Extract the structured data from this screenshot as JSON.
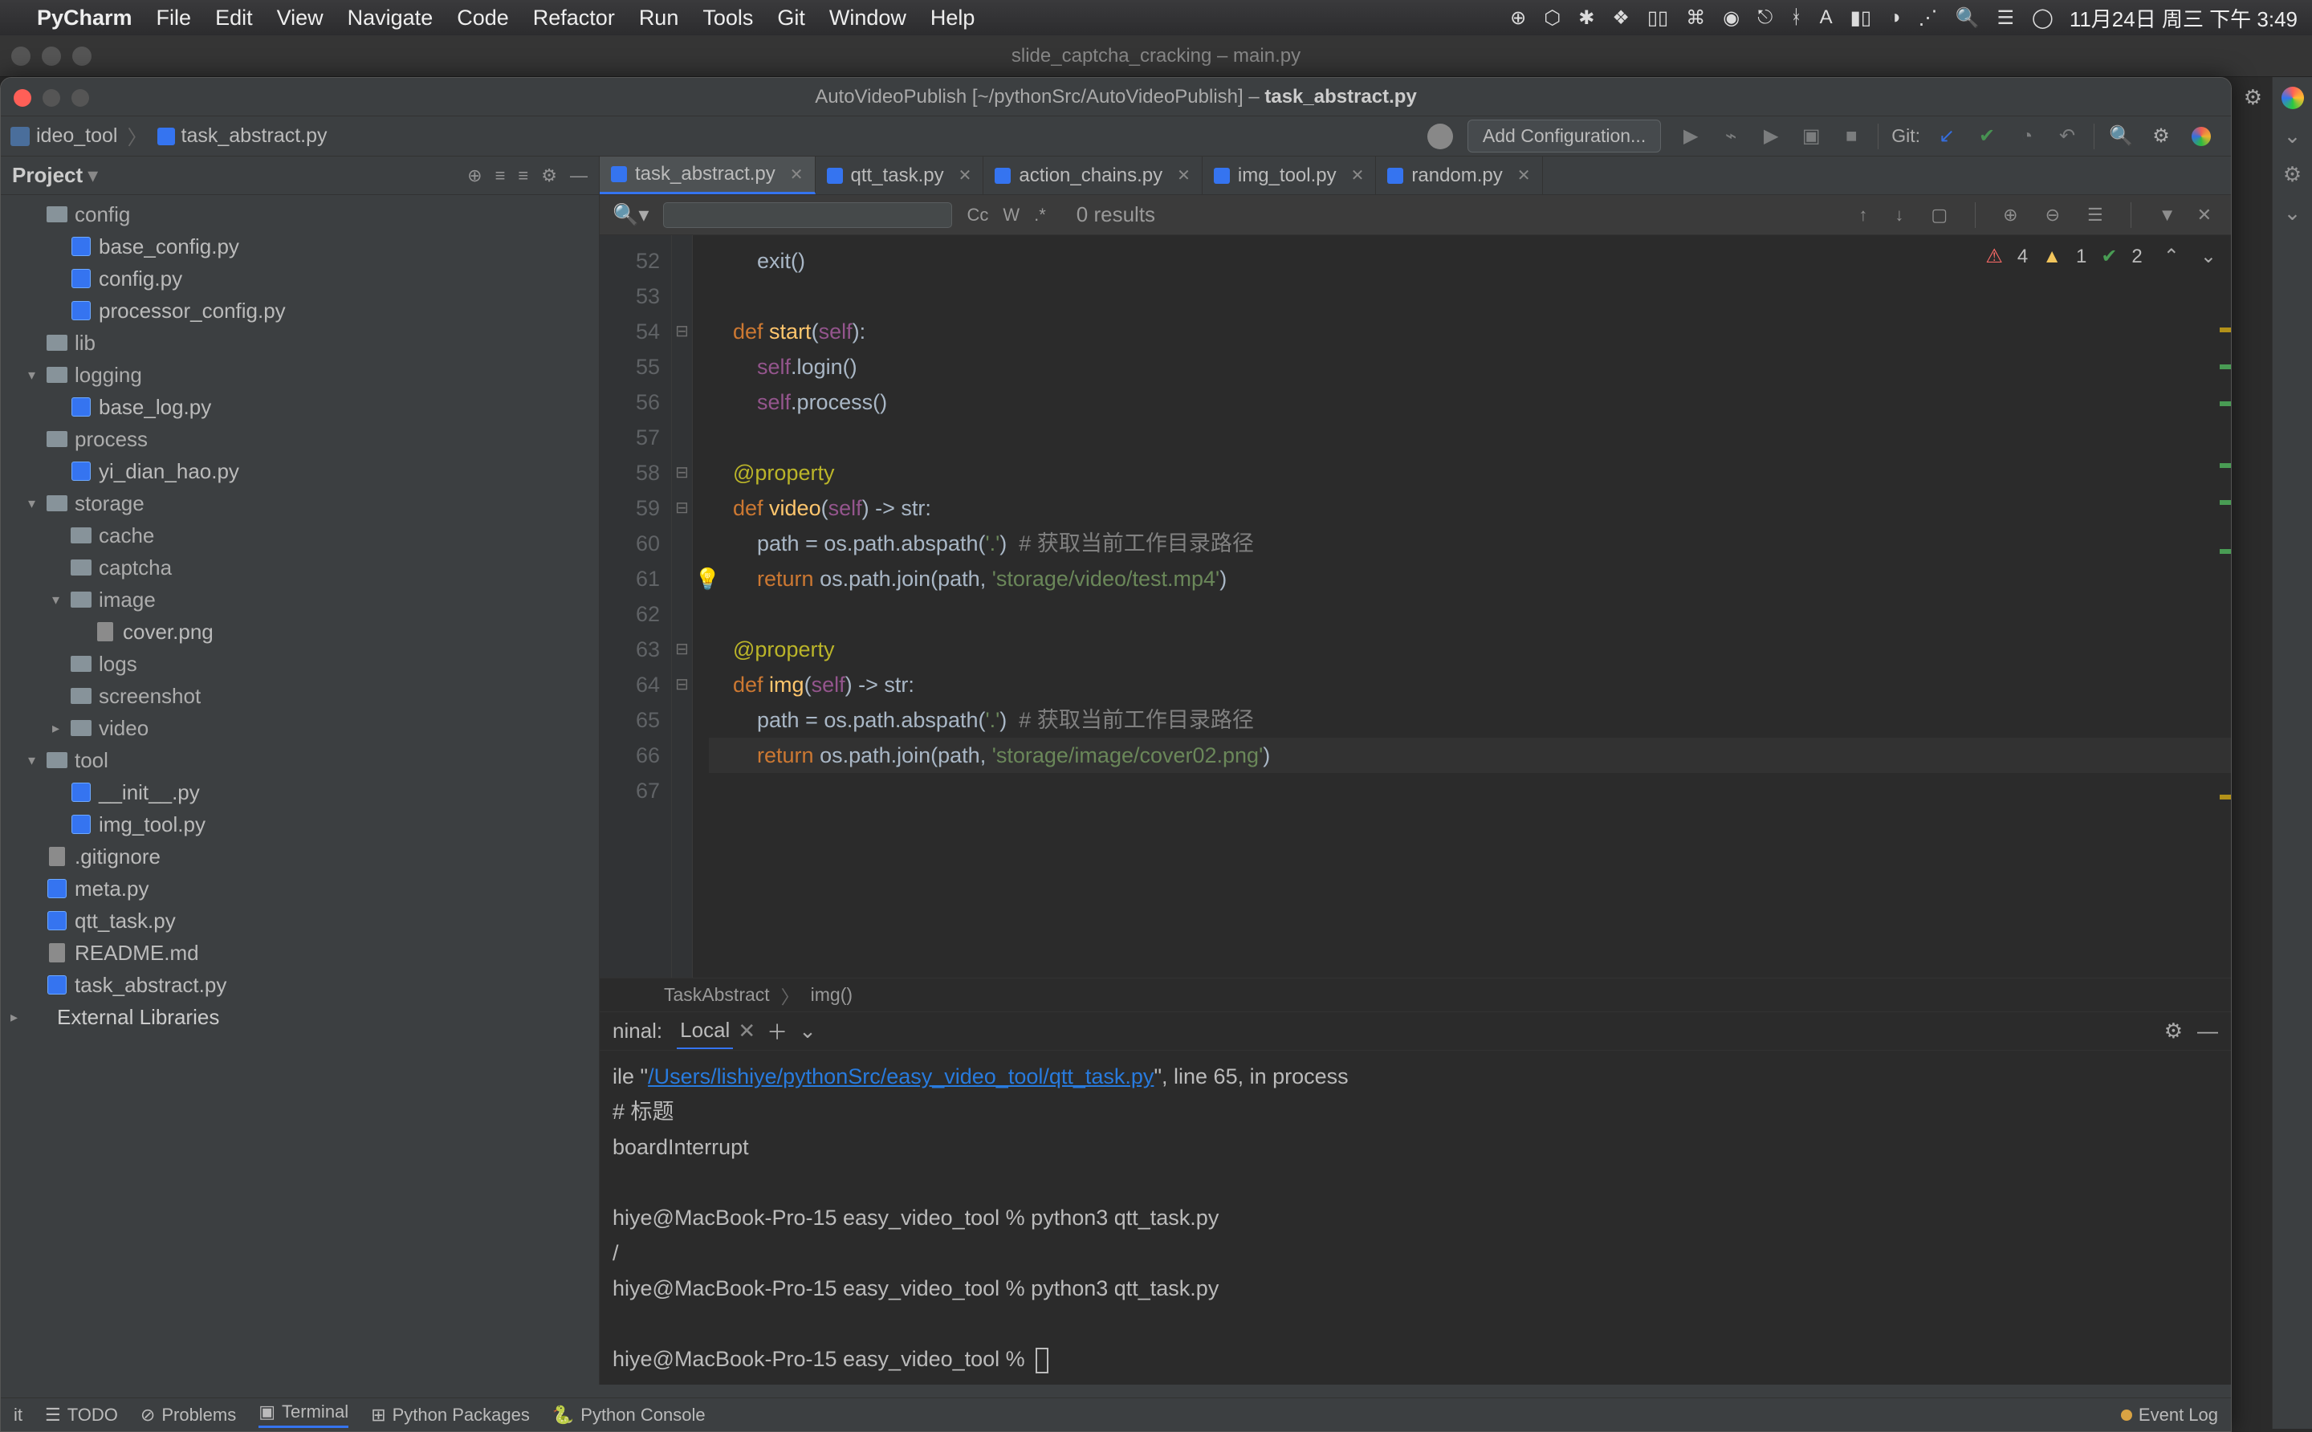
{
  "menubar": {
    "app": "PyCharm",
    "items": [
      "File",
      "Edit",
      "View",
      "Navigate",
      "Code",
      "Refactor",
      "Run",
      "Tools",
      "Git",
      "Window",
      "Help"
    ],
    "clock": "11月24日 周三 下午 3:49"
  },
  "bgwin_title": "slide_captcha_cracking – main.py",
  "mainwin_title_prefix": "AutoVideoPublish [~/pythonSrc/AutoVideoPublish] – ",
  "mainwin_title_file": "task_abstract.py",
  "breadcrumb": {
    "folder": "ideo_tool",
    "file": "task_abstract.py"
  },
  "toolbar": {
    "add_config": "Add Configuration...",
    "git": "Git:"
  },
  "sidebar": {
    "title": "Project"
  },
  "tree": [
    {
      "d": 1,
      "t": "folder",
      "a": "",
      "n": "config"
    },
    {
      "d": 2,
      "t": "pyfile",
      "n": "base_config.py"
    },
    {
      "d": 2,
      "t": "pyfile",
      "n": "config.py"
    },
    {
      "d": 2,
      "t": "pyfile",
      "n": "processor_config.py"
    },
    {
      "d": 1,
      "t": "folder",
      "a": "",
      "n": "lib"
    },
    {
      "d": 1,
      "t": "folder",
      "a": "▾",
      "n": "logging"
    },
    {
      "d": 2,
      "t": "pyfile",
      "n": "base_log.py"
    },
    {
      "d": 1,
      "t": "folder",
      "a": "",
      "n": "process"
    },
    {
      "d": 2,
      "t": "pyfile",
      "n": "yi_dian_hao.py"
    },
    {
      "d": 1,
      "t": "folder",
      "a": "▾",
      "n": "storage"
    },
    {
      "d": 2,
      "t": "folder",
      "a": "",
      "n": "cache"
    },
    {
      "d": 2,
      "t": "folder",
      "a": "",
      "n": "captcha"
    },
    {
      "d": 2,
      "t": "folder",
      "a": "▾",
      "n": "image"
    },
    {
      "d": 3,
      "t": "file",
      "n": "cover.png"
    },
    {
      "d": 2,
      "t": "folder",
      "a": "",
      "n": "logs"
    },
    {
      "d": 2,
      "t": "folder",
      "a": "",
      "n": "screenshot"
    },
    {
      "d": 2,
      "t": "folder",
      "a": "▸",
      "n": "video"
    },
    {
      "d": 1,
      "t": "folder",
      "a": "▾",
      "n": "tool"
    },
    {
      "d": 2,
      "t": "pyfile",
      "n": "__init__.py"
    },
    {
      "d": 2,
      "t": "pyfile",
      "n": "img_tool.py"
    },
    {
      "d": 1,
      "t": "file",
      "n": ".gitignore"
    },
    {
      "d": 1,
      "t": "pyfile",
      "n": "meta.py"
    },
    {
      "d": 1,
      "t": "pyfile",
      "n": "qtt_task.py"
    },
    {
      "d": 1,
      "t": "file",
      "n": "README.md"
    },
    {
      "d": 1,
      "t": "pyfile",
      "n": "task_abstract.py"
    },
    {
      "d": 0,
      "t": "ext",
      "a": "▸",
      "n": "External Libraries"
    }
  ],
  "tabs": [
    {
      "label": "task_abstract.py",
      "active": true
    },
    {
      "label": "qtt_task.py"
    },
    {
      "label": "action_chains.py"
    },
    {
      "label": "img_tool.py"
    },
    {
      "label": "random.py"
    }
  ],
  "find": {
    "results": "0 results"
  },
  "inspections": {
    "err": "4",
    "warn": "1",
    "typo": "2"
  },
  "gutter_start": 52,
  "gutter_end": 67,
  "code": {
    "l52": "        exit()",
    "l54_def": "    def ",
    "l54_fn": "start",
    "l54_rest": "(",
    "l54_self": "self",
    "l54_tail": "):",
    "l55": "        ",
    "l55_self": "self",
    "l55_rest": ".login()",
    "l56": "        ",
    "l56_self": "self",
    "l56_rest": ".process()",
    "l58": "    @property",
    "l59_def": "    def ",
    "l59_fn": "video",
    "l59_rest": "(",
    "l59_self": "self",
    "l59_mid": ") -> ",
    "l59_ty": "str",
    "l59_tail": ":",
    "l60_a": "        path = os.path.abspath(",
    "l60_str": "'.'",
    "l60_b": ")  ",
    "l60_c": "# 获取当前工作目录路径",
    "l61_a": "        ",
    "l61_ret": "return ",
    "l61_b": "os.path.join(path, ",
    "l61_str": "'storage/video/test.mp4'",
    "l61_c": ")",
    "l63": "    @property",
    "l64_def": "    def ",
    "l64_fn": "img",
    "l64_rest": "(",
    "l64_self": "self",
    "l64_mid": ") -> ",
    "l64_ty": "str",
    "l64_tail": ":",
    "l65_a": "        path = os.path.abspath(",
    "l65_str": "'.'",
    "l65_b": ")  ",
    "l65_c": "# 获取当前工作目录路径",
    "l66_a": "        ",
    "l66_ret": "return ",
    "l66_b": "os.path.join(path, ",
    "l66_str": "'storage/image/cover02.png'",
    "l66_c": ")"
  },
  "crumbs": {
    "a": "TaskAbstract",
    "b": "img()"
  },
  "terminal": {
    "label": "ninal:",
    "local": "Local",
    "l1a": "ile \"",
    "l1link": "/Users/lishiye/pythonSrc/easy_video_tool/qtt_task.py",
    "l1b": "\", line 65, in process",
    "l2": "    # 标题",
    "l3": "boardInterrupt",
    "l4": "hiye@MacBook-Pro-15 easy_video_tool % python3 qtt_task.py",
    "l5": "/",
    "l6": "hiye@MacBook-Pro-15 easy_video_tool % python3 qtt_task.py",
    "l7": "hiye@MacBook-Pro-15 easy_video_tool % "
  },
  "status": {
    "items": [
      "it",
      "TODO",
      "Problems",
      "Terminal",
      "Python Packages",
      "Python Console"
    ],
    "event": "Event Log"
  }
}
